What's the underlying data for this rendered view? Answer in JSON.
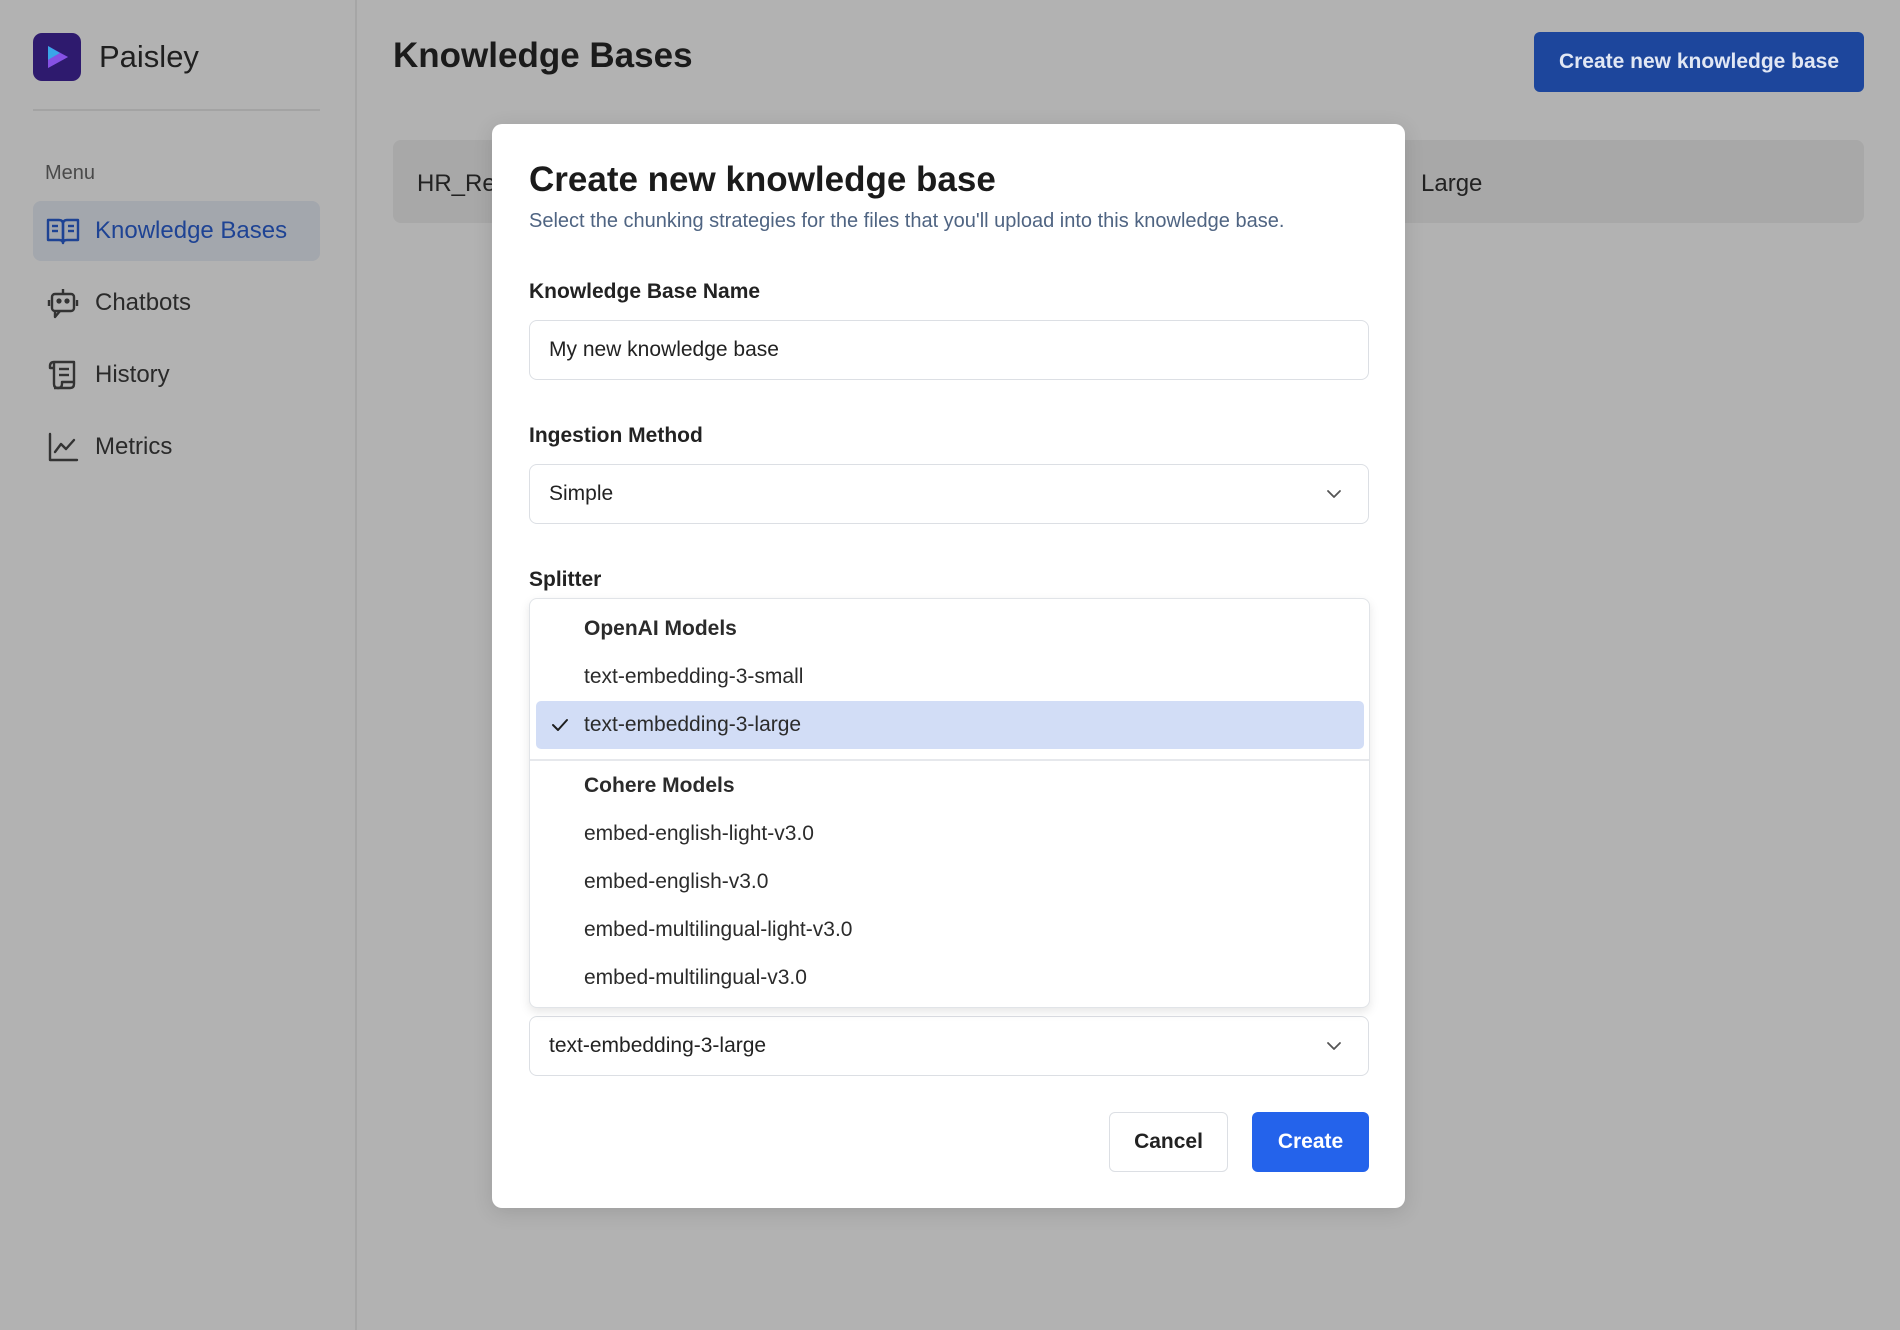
{
  "app": {
    "name": "Paisley"
  },
  "sidebar": {
    "menu_title": "Menu",
    "items": [
      {
        "label": "Knowledge Bases",
        "icon": "book-open-icon",
        "active": true
      },
      {
        "label": "Chatbots",
        "icon": "bot-icon",
        "active": false
      },
      {
        "label": "History",
        "icon": "scroll-icon",
        "active": false
      },
      {
        "label": "Metrics",
        "icon": "line-chart-icon",
        "active": false
      }
    ]
  },
  "header": {
    "title": "Knowledge Bases",
    "create_button": "Create new knowledge base"
  },
  "knowledge_bases": [
    {
      "name": "HR_Re",
      "model": "Large"
    }
  ],
  "modal": {
    "title": "Create new knowledge base",
    "subtitle": "Select the chunking strategies for the files that you'll upload into this knowledge base.",
    "name_label": "Knowledge Base Name",
    "name_value": "My new knowledge base",
    "ingestion_label": "Ingestion Method",
    "ingestion_value": "Simple",
    "splitter_label": "Splitter",
    "embedding_value": "text-embedding-3-large",
    "cancel_label": "Cancel",
    "create_label": "Create",
    "dropdown": {
      "groups": [
        {
          "label": "OpenAI Models",
          "options": [
            "text-embedding-3-small",
            "text-embedding-3-large"
          ]
        },
        {
          "label": "Cohere Models",
          "options": [
            "embed-english-light-v3.0",
            "embed-english-v3.0",
            "embed-multilingual-light-v3.0",
            "embed-multilingual-v3.0"
          ]
        }
      ],
      "selected": "text-embedding-3-large"
    }
  },
  "colors": {
    "accent": "#2463eb",
    "overlay_bg": "#b2b2b2",
    "selected_option_bg": "#d2ddf6",
    "nav_active_text": "#1e4394"
  }
}
